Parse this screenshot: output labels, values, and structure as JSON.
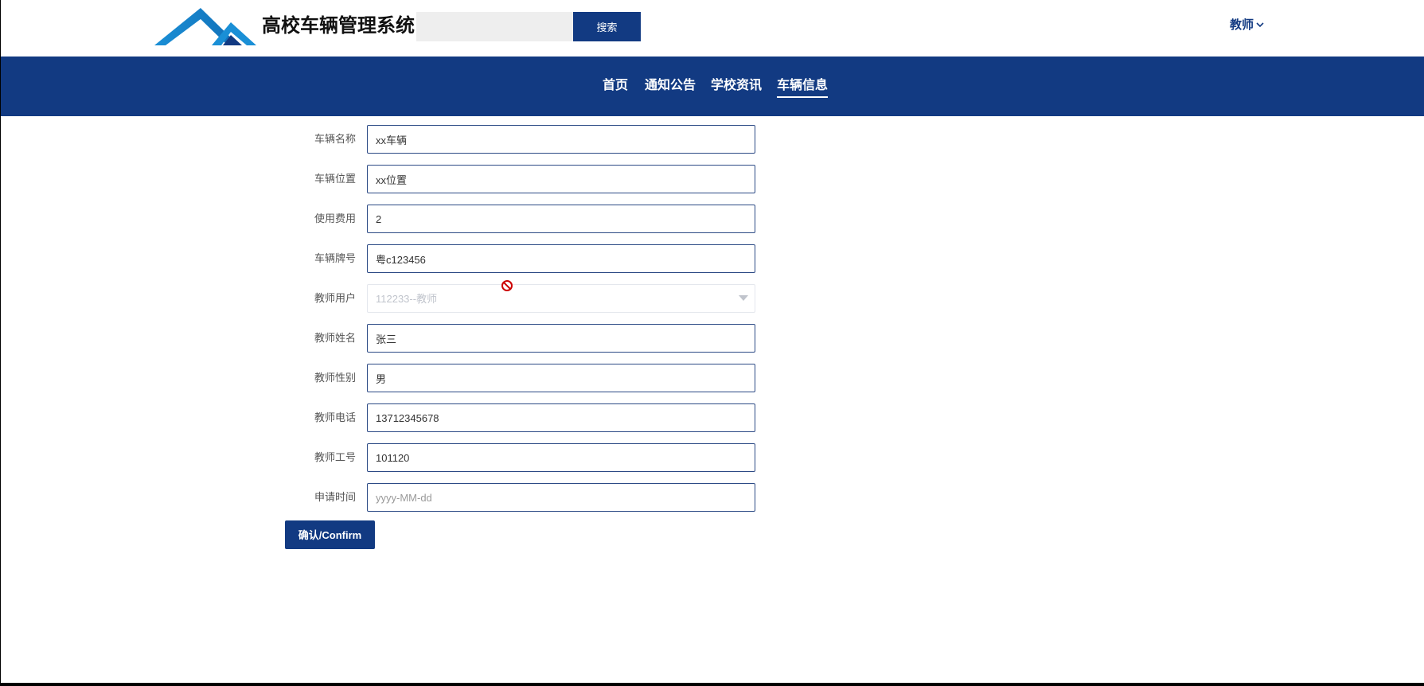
{
  "header": {
    "site_title": "高校车辆管理系统",
    "search_placeholder": "",
    "search_button": "搜索",
    "user_menu_label": "教师",
    "logo_icon": "mountain-logo-icon",
    "chevron_icon": "chevron-down-icon"
  },
  "nav": {
    "items": [
      {
        "label": "首页",
        "active": false
      },
      {
        "label": "通知公告",
        "active": false
      },
      {
        "label": "学校资讯",
        "active": false
      },
      {
        "label": "车辆信息",
        "active": true
      }
    ]
  },
  "form": {
    "fields": [
      {
        "label": "车辆名称",
        "value": "xx车辆",
        "placeholder": ""
      },
      {
        "label": "车辆位置",
        "value": "xx位置",
        "placeholder": ""
      },
      {
        "label": "使用费用",
        "value": "2",
        "placeholder": ""
      },
      {
        "label": "车辆牌号",
        "value": "粤c123456",
        "placeholder": ""
      },
      {
        "label": "教师用户",
        "value": "112233--教师",
        "disabled": true,
        "type": "select"
      },
      {
        "label": "教师姓名",
        "value": "张三",
        "placeholder": ""
      },
      {
        "label": "教师性别",
        "value": "男",
        "placeholder": ""
      },
      {
        "label": "教师电话",
        "value": "13712345678",
        "placeholder": ""
      },
      {
        "label": "教师工号",
        "value": "101120",
        "placeholder": ""
      },
      {
        "label": "申请时间",
        "value": "",
        "placeholder": "yyyy-MM-dd"
      }
    ],
    "confirm_button": "确认/Confirm"
  },
  "colors": {
    "primary": "#123a82",
    "input_border": "#2c4a85",
    "disabled_text": "#c0c4cc",
    "not_allowed_cursor": "#cc0000"
  },
  "icons": {
    "select_arrow": "caret-down-icon",
    "cursor": "not-allowed-cursor-icon"
  }
}
